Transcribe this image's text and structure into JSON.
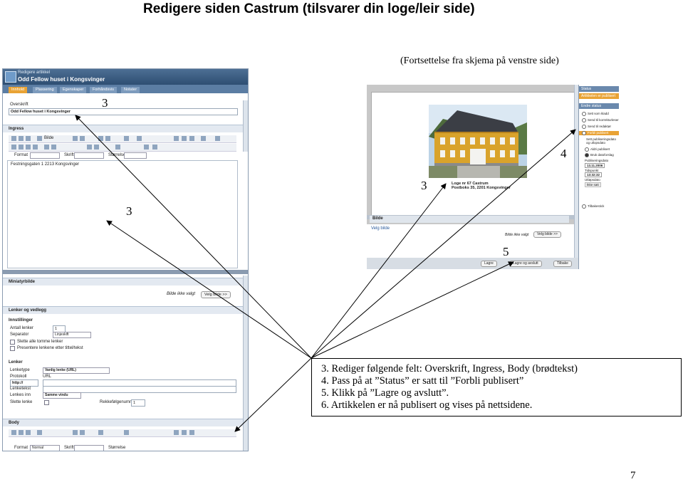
{
  "page": {
    "title": "Redigere siden Castrum (tilsvarer din loge/leir side)",
    "subtitle": "(Fortsettelse fra skjema på venstre side)",
    "page_number": "7"
  },
  "markers": {
    "m3_top": "3",
    "m3_left": "3",
    "m3_photo": "3",
    "m4": "4",
    "m5": "5"
  },
  "left_screenshot": {
    "header_small": "Redigere artikkel",
    "header_title": "Odd Fellow huset i Kongsvinger",
    "tabs": [
      "Innhold",
      "Plassering",
      "Egenskaper",
      "Forhåndsvis",
      "Notater"
    ],
    "overskrift_label": "Overskrift",
    "overskrift_value": "Odd Fellow huset i Kongsvinger",
    "ingress_label": "Ingress",
    "bilde_label": "Bilde",
    "format_label": "Format",
    "skrift_label": "Skrift",
    "storrelse_label": "Størrelse",
    "body_text": "Festningsgaten 1 2213 Kongsvinger",
    "miniatyrbilde_label": "Miniatyrbilde",
    "bilde_ikke_valgt": "Bilde ikke valgt",
    "velg_bilde": "Velg bilde >>",
    "lenker_label": "Lenker og vedlegg",
    "innstillinger_label": "Innstillinger",
    "antall_lenker_label": "Antall lenker",
    "antall_lenker_value": "1",
    "separator_label": "Separator",
    "separator_value": "Linjeskift",
    "slett_tomme": "Slette alle tomme lenker",
    "presentere": "Presentere lenkene etter tittel/tekst",
    "lenker_sub": "Lenker",
    "lenketype_label": "Lenketype",
    "lenketype_value": "Vanlig lenke (URL)",
    "protokoll_label": "Protokoll",
    "protokoll_value": "http://",
    "url_label": "URL",
    "lenketekst_label": "Lenketekst",
    "lenkes_inn_label": "Lenkes inn",
    "lenkes_inn_value": "Samme vindu",
    "slette_lenke_label": "Slette lenke",
    "rekkefolge_label": "Rekkefølgenummer",
    "rekkefolge_value": "1",
    "body_label": "Body",
    "format_value": "Normal"
  },
  "right_screenshot": {
    "caption_line1": "Loge nr 67 Castrum",
    "caption_line2": "Postboks 35, 2201 Kongsvinger",
    "bilde_label": "Bilde",
    "velg_bilde_link": "Velg bilde",
    "bilde_ikke_valgt": "Bilde ikke valgt",
    "velg_bilde_btn": "Velg bilde >>",
    "buttons": [
      "Lagre",
      "Lagre og avslutt",
      "Tilbake"
    ],
    "status_header": "Status",
    "status_sub": "Artikkelen er publisert",
    "endre_status": "Endre status",
    "options": [
      "Sett som kladd",
      "Send til korrekturleser",
      "Send til redaktør",
      "Forbli publisert"
    ],
    "publisering_label": "Sett publiseringsdato og utlopsdato",
    "aldri_publiser": "Aldri publisert",
    "bruk_datoforslag": "Bruk datoforslag",
    "publiseringsdato_label": "Publiseringsdato",
    "publiseringsdato_value": "13.11.2006",
    "tidspunkt_label": "Tidspunkt",
    "tidspunkt_value": "13:32:32",
    "utlopsdato_label": "Utløpsdato",
    "utlopsdato_value": "Ikke satt",
    "tilbakelinje": "Tilbakestick"
  },
  "instructions": [
    "3.  Rediger følgende felt: Overskrift, Ingress, Body (brødtekst)",
    "4.  Pass på at ”Status” er satt til ”Forbli publisert”",
    "5.  Klikk på ”Lagre og avslutt”.",
    "6.  Artikkelen er nå publisert og vises på nettsidene."
  ]
}
